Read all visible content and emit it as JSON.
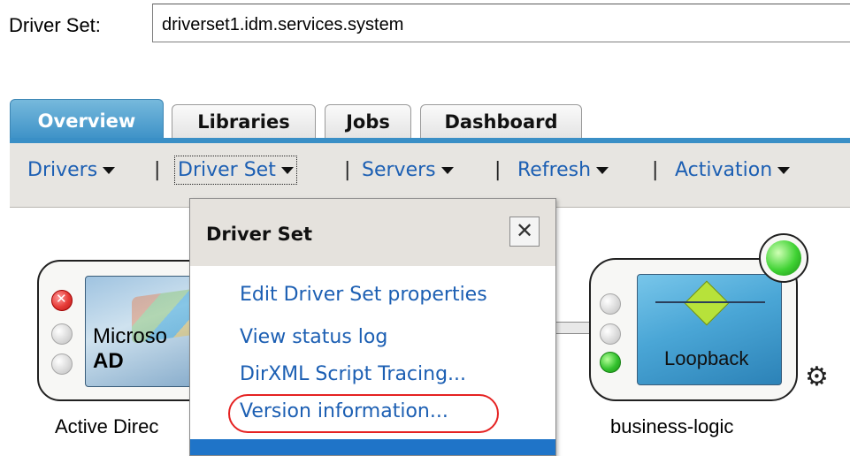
{
  "driver_set": {
    "label": "Driver Set:",
    "value": "driverset1.idm.services.system"
  },
  "tabs": [
    {
      "label": "Overview",
      "active": true
    },
    {
      "label": "Libraries",
      "active": false
    },
    {
      "label": "Jobs",
      "active": false
    },
    {
      "label": "Dashboard",
      "active": false
    }
  ],
  "menubar": {
    "items": [
      {
        "label": "Drivers"
      },
      {
        "label": "Driver Set"
      },
      {
        "label": "Servers"
      },
      {
        "label": "Refresh"
      },
      {
        "label": "Activation"
      }
    ],
    "separator": "|"
  },
  "popup": {
    "title": "Driver Set",
    "items": [
      {
        "label": "Edit Driver Set properties"
      },
      {
        "label": "View status log"
      },
      {
        "label": "DirXML Script Tracing..."
      },
      {
        "label": "Version information..."
      }
    ]
  },
  "drivers": [
    {
      "name": "Active Directory",
      "thumb_text_top": "Microso",
      "thumb_text_bottom": "AD",
      "caption": "Active Direc"
    },
    {
      "name": "business-logic",
      "thumb_text": "Loopback",
      "caption": "business-logic"
    }
  ],
  "colors": {
    "link": "#1c5fb3",
    "tab_active": "#3a8fc6",
    "highlight": "#e52222"
  }
}
